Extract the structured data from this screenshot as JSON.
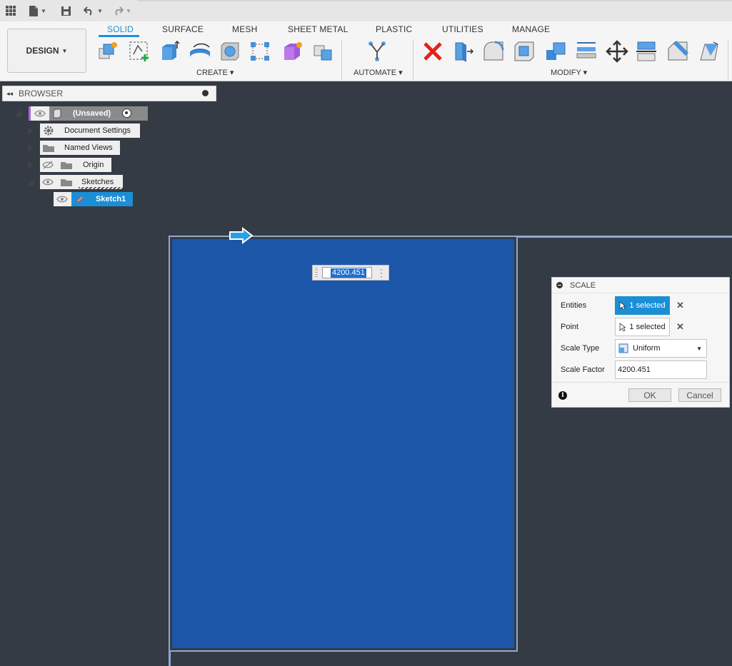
{
  "toolbar": {
    "workspace": "DESIGN",
    "tabs": [
      {
        "label": "SOLID",
        "active": true
      },
      {
        "label": "SURFACE",
        "active": false
      },
      {
        "label": "MESH",
        "active": false
      },
      {
        "label": "SHEET METAL",
        "active": false
      },
      {
        "label": "PLASTIC",
        "active": false
      },
      {
        "label": "UTILITIES",
        "active": false
      },
      {
        "label": "MANAGE",
        "active": false
      }
    ],
    "groups": {
      "create": "CREATE",
      "automate": "AUTOMATE",
      "modify": "MODIFY"
    },
    "icons": {
      "create": [
        "new-component-icon",
        "create-sketch-icon",
        "extrude-icon",
        "revolve-icon",
        "hole-icon",
        "pattern-icon",
        "create-form-icon",
        "derive-icon"
      ],
      "automate": [
        "automate-icon"
      ],
      "modify": [
        "delete-icon",
        "press-pull-icon",
        "fillet-icon",
        "shell-icon",
        "combine-icon",
        "offset-face-icon",
        "move-icon",
        "align-icon",
        "chamfer-icon",
        "draft-icon"
      ]
    }
  },
  "browser": {
    "title": "BROWSER",
    "root": "(Unsaved)",
    "items": [
      {
        "label": "Document Settings"
      },
      {
        "label": "Named Views"
      },
      {
        "label": "Origin"
      },
      {
        "label": "Sketches"
      },
      {
        "label": "Sketch1"
      }
    ]
  },
  "canvas": {
    "dimension_value": "4200.451"
  },
  "dialog": {
    "title": "SCALE",
    "entities_label": "Entities",
    "entities_value": "1 selected",
    "point_label": "Point",
    "point_value": "1 selected",
    "scale_type_label": "Scale Type",
    "scale_type_value": "Uniform",
    "scale_factor_label": "Scale Factor",
    "scale_factor_value": "4200.451",
    "ok": "OK",
    "cancel": "Cancel"
  },
  "colors": {
    "accent": "#1f8fd8",
    "plate": "#1c56a8",
    "canvas": "#353b45"
  }
}
